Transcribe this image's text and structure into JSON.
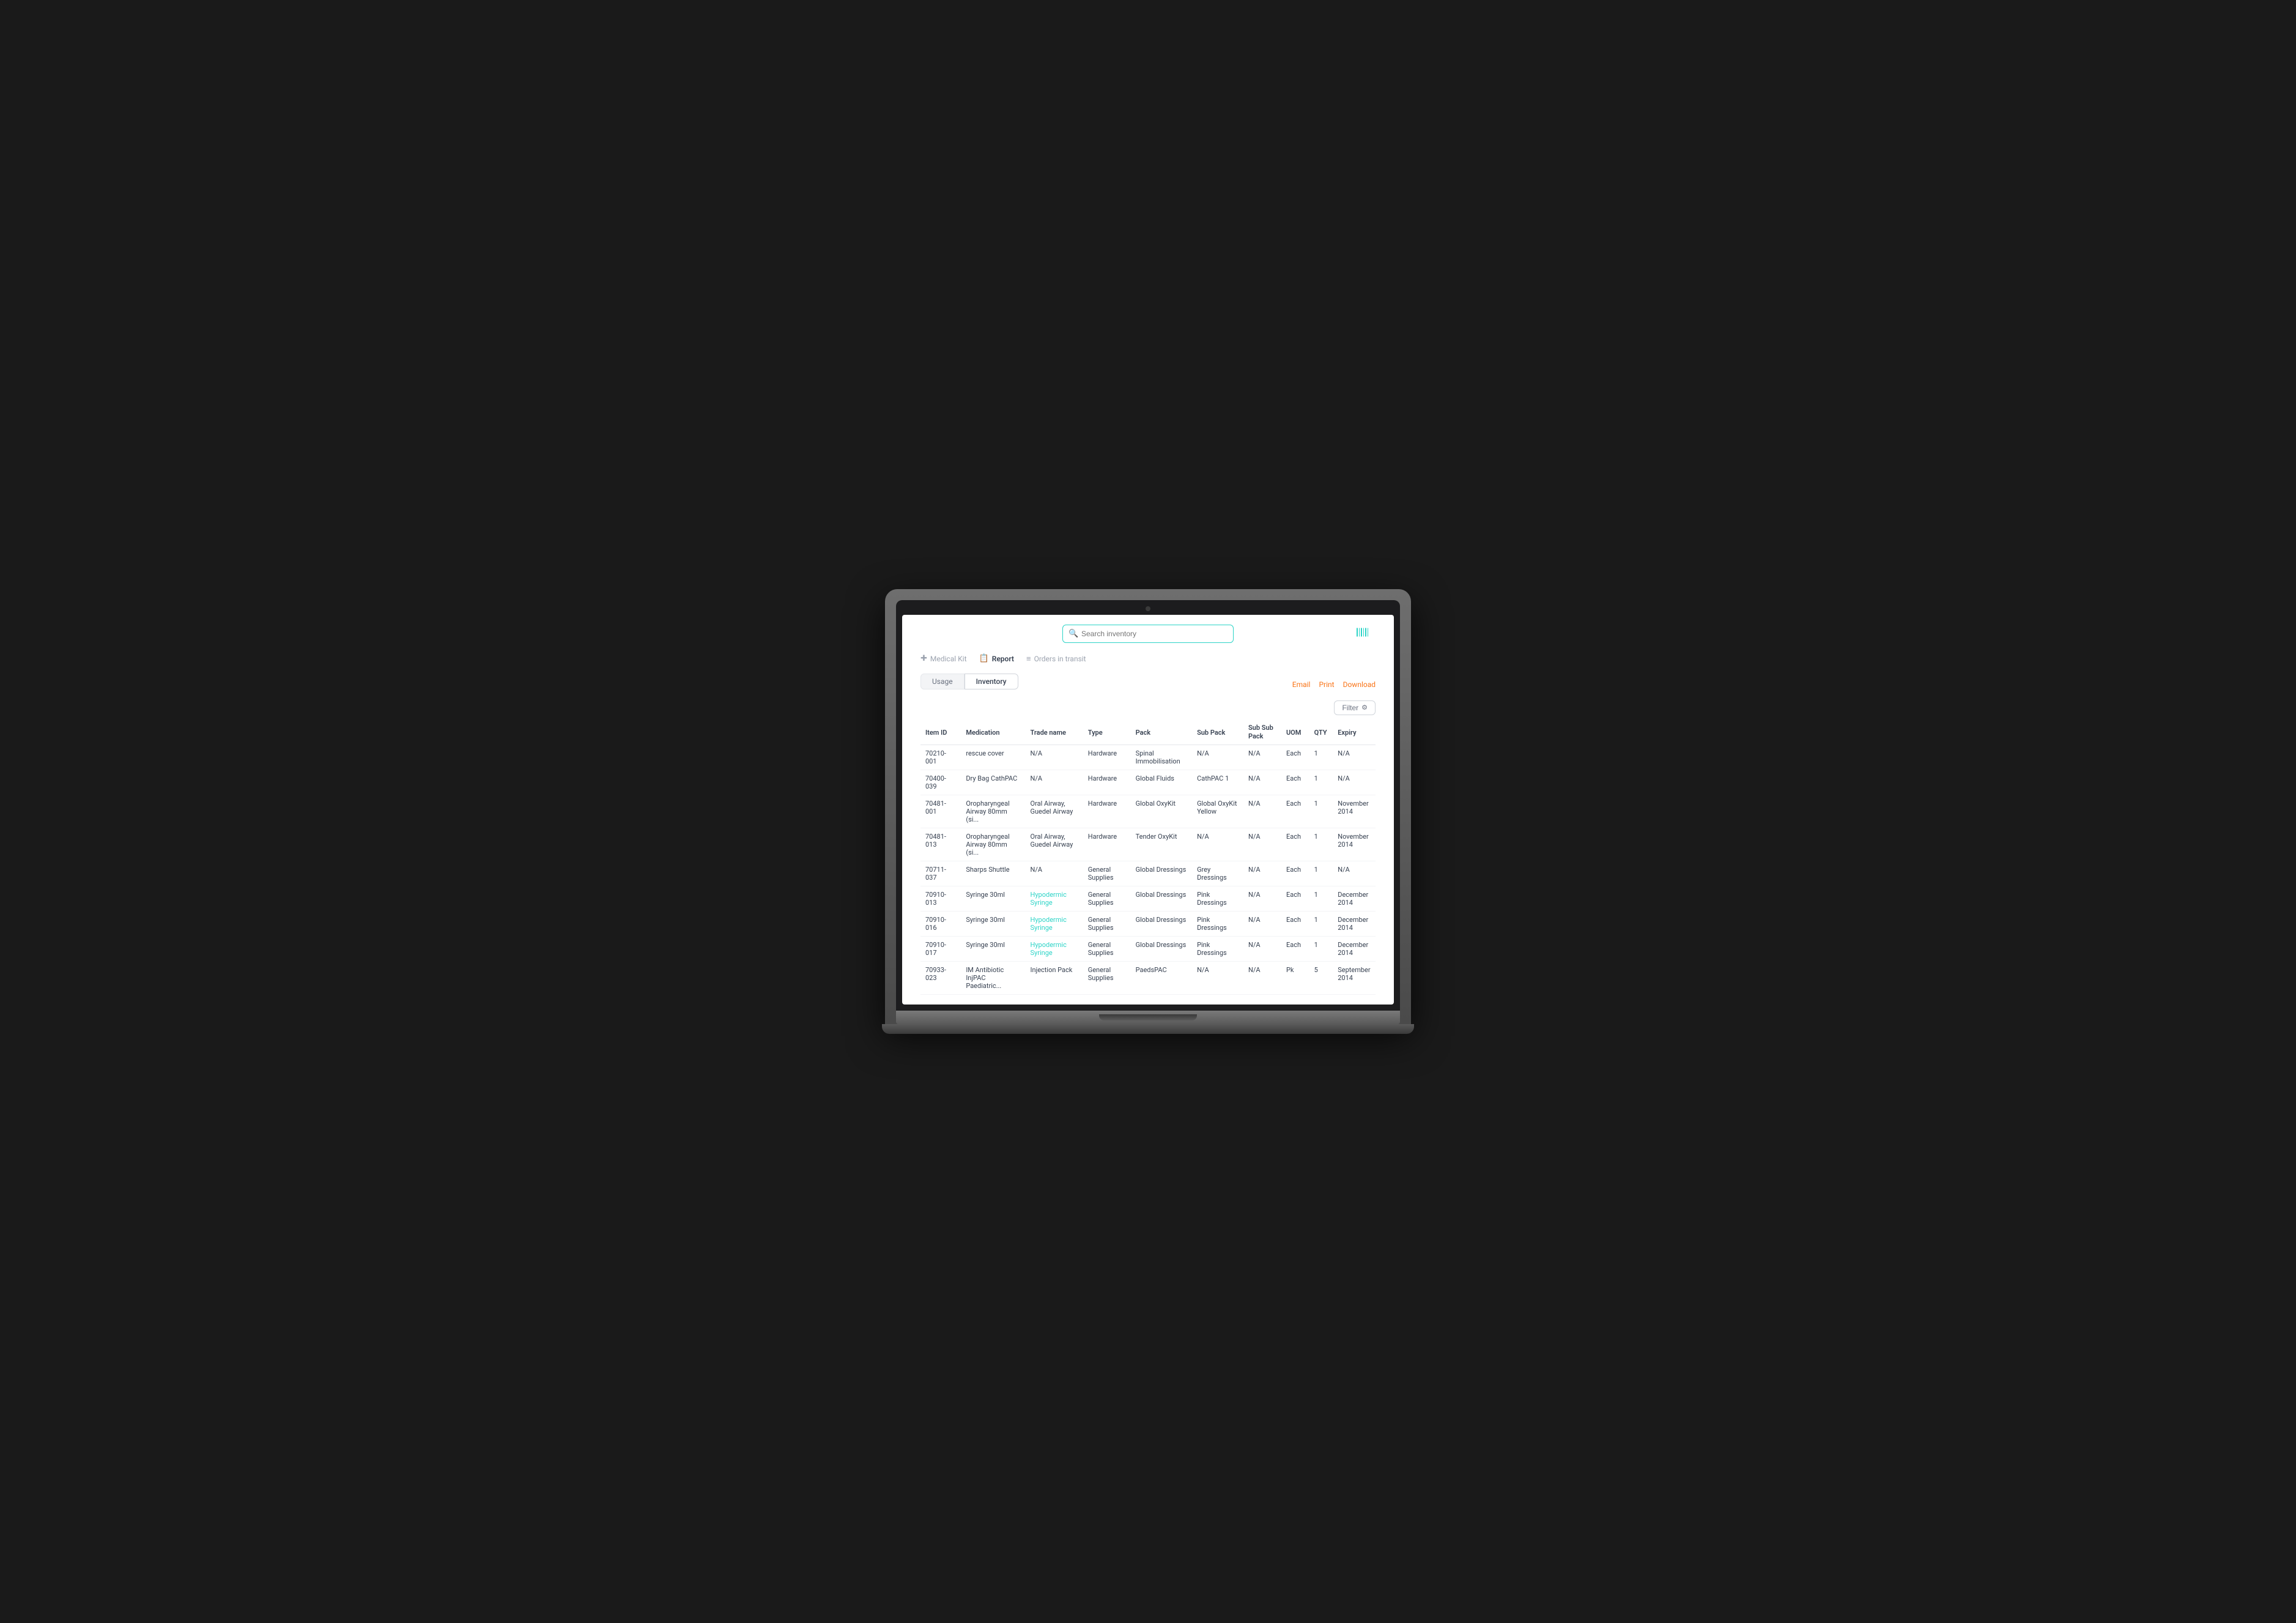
{
  "header": {
    "search_placeholder": "Search inventory",
    "barcode_icon": "▐║▌"
  },
  "nav": {
    "tabs": [
      {
        "id": "medical-kit",
        "label": "Medical Kit",
        "icon": "✚",
        "active": false
      },
      {
        "id": "report",
        "label": "Report",
        "icon": "📋",
        "active": true
      },
      {
        "id": "orders-in-transit",
        "label": "Orders in transit",
        "icon": "≡",
        "active": false
      }
    ]
  },
  "sub_tabs": [
    {
      "id": "usage",
      "label": "Usage",
      "active": false
    },
    {
      "id": "inventory",
      "label": "Inventory",
      "active": true
    }
  ],
  "actions": {
    "email": "Email",
    "print": "Print",
    "download": "Download",
    "filter": "Filter"
  },
  "table": {
    "columns": [
      {
        "id": "item_id",
        "label": "Item ID"
      },
      {
        "id": "medication",
        "label": "Medication"
      },
      {
        "id": "trade_name",
        "label": "Trade name"
      },
      {
        "id": "type",
        "label": "Type"
      },
      {
        "id": "pack",
        "label": "Pack"
      },
      {
        "id": "sub_pack",
        "label": "Sub Pack"
      },
      {
        "id": "sub_sub_pack",
        "label": "Sub Sub Pack"
      },
      {
        "id": "uom",
        "label": "UOM"
      },
      {
        "id": "qty",
        "label": "QTY"
      },
      {
        "id": "expiry",
        "label": "Expiry"
      }
    ],
    "rows": [
      {
        "item_id": "70210-001",
        "medication": "rescue cover",
        "trade_name": "N/A",
        "type": "Hardware",
        "pack": "Spinal Immobilisation",
        "sub_pack": "N/A",
        "sub_sub_pack": "N/A",
        "uom": "Each",
        "qty": "1",
        "expiry": "N/A",
        "trade_is_link": false
      },
      {
        "item_id": "70400-039",
        "medication": "Dry Bag CathPAC",
        "trade_name": "N/A",
        "type": "Hardware",
        "pack": "Global Fluids",
        "sub_pack": "CathPAC 1",
        "sub_sub_pack": "N/A",
        "uom": "Each",
        "qty": "1",
        "expiry": "N/A",
        "trade_is_link": false
      },
      {
        "item_id": "70481-001",
        "medication": "Oropharyngeal Airway 80mm (si...",
        "trade_name": "Oral Airway, Guedel Airway",
        "type": "Hardware",
        "pack": "Global OxyKit",
        "sub_pack": "Global OxyKit Yellow",
        "sub_sub_pack": "N/A",
        "uom": "Each",
        "qty": "1",
        "expiry": "November 2014",
        "trade_is_link": false
      },
      {
        "item_id": "70481-013",
        "medication": "Oropharyngeal Airway 80mm (si...",
        "trade_name": "Oral Airway, Guedel Airway",
        "type": "Hardware",
        "pack": "Tender OxyKit",
        "sub_pack": "N/A",
        "sub_sub_pack": "N/A",
        "uom": "Each",
        "qty": "1",
        "expiry": "November 2014",
        "trade_is_link": false
      },
      {
        "item_id": "70711-037",
        "medication": "Sharps Shuttle",
        "trade_name": "N/A",
        "type": "General Supplies",
        "pack": "Global Dressings",
        "sub_pack": "Grey Dressings",
        "sub_sub_pack": "N/A",
        "uom": "Each",
        "qty": "1",
        "expiry": "N/A",
        "trade_is_link": false
      },
      {
        "item_id": "70910-013",
        "medication": "Syringe 30ml",
        "trade_name": "Hypodermic Syringe",
        "type": "General Supplies",
        "pack": "Global Dressings",
        "sub_pack": "Pink Dressings",
        "sub_sub_pack": "N/A",
        "uom": "Each",
        "qty": "1",
        "expiry": "December 2014",
        "trade_is_link": true
      },
      {
        "item_id": "70910-016",
        "medication": "Syringe 30ml",
        "trade_name": "Hypodermic Syringe",
        "type": "General Supplies",
        "pack": "Global Dressings",
        "sub_pack": "Pink Dressings",
        "sub_sub_pack": "N/A",
        "uom": "Each",
        "qty": "1",
        "expiry": "December 2014",
        "trade_is_link": true
      },
      {
        "item_id": "70910-017",
        "medication": "Syringe 30ml",
        "trade_name": "Hypodermic Syringe",
        "type": "General Supplies",
        "pack": "Global Dressings",
        "sub_pack": "Pink Dressings",
        "sub_sub_pack": "N/A",
        "uom": "Each",
        "qty": "1",
        "expiry": "December 2014",
        "trade_is_link": true
      },
      {
        "item_id": "70933-023",
        "medication": "IM Antibiotic InjPAC Paediatric...",
        "trade_name": "Injection Pack",
        "type": "General Supplies",
        "pack": "PaedsPAC",
        "sub_pack": "N/A",
        "sub_sub_pack": "N/A",
        "uom": "Pk",
        "qty": "5",
        "expiry": "September 2014",
        "trade_is_link": false
      }
    ]
  }
}
